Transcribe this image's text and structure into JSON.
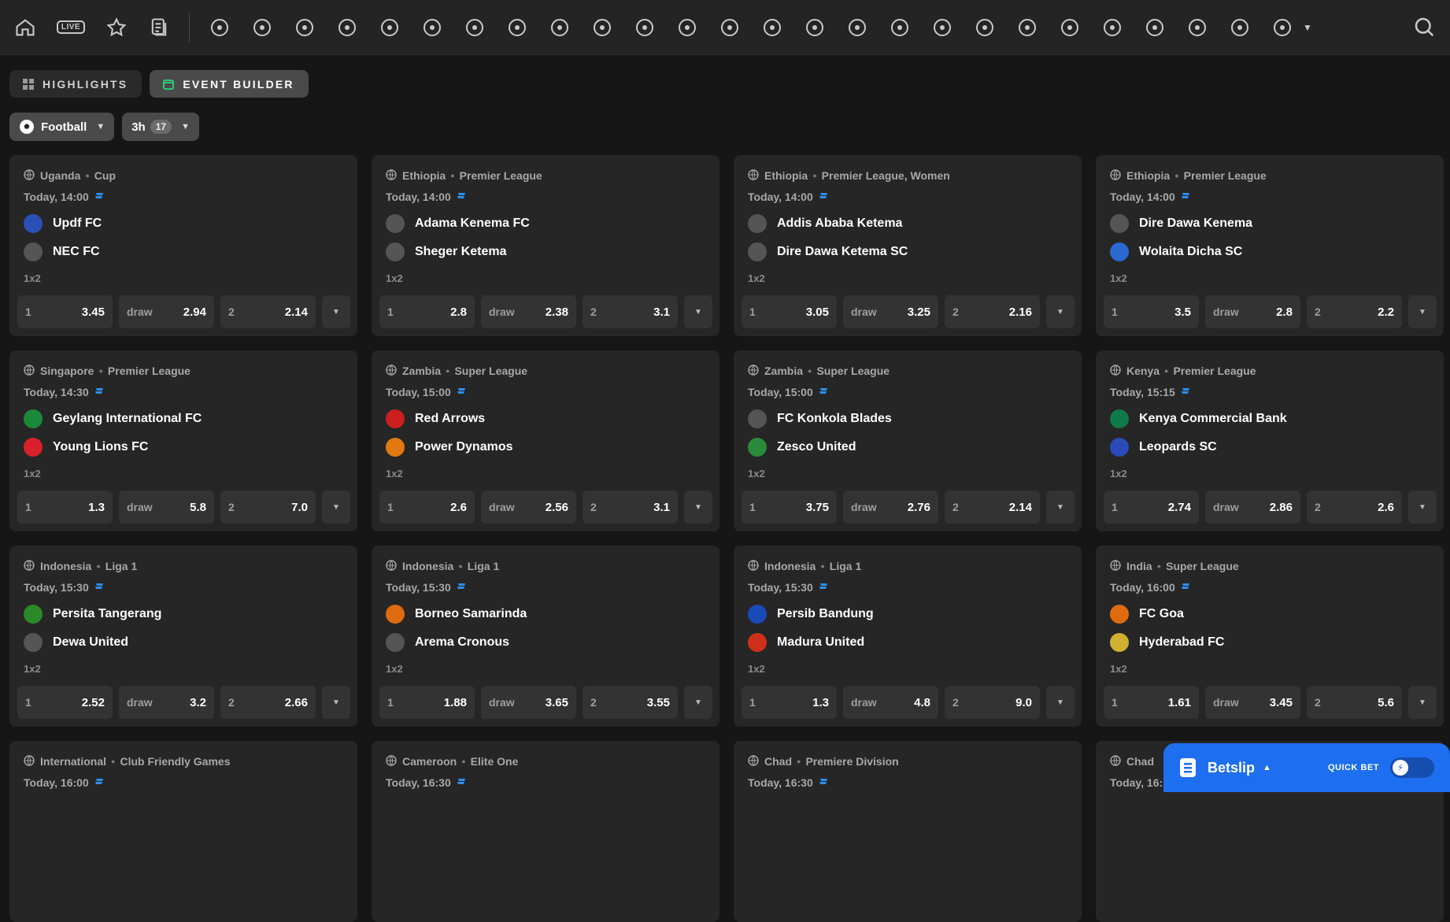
{
  "nav": {
    "live_label": "LIVE",
    "icons": [
      "home-icon",
      "live-icon",
      "star-icon",
      "betslip-list-icon",
      "football-icon",
      "basketball-icon",
      "tennis-icon",
      "esoccer-icon",
      "ice-hockey-icon",
      "table-tennis-icon",
      "counter-strike-icon",
      "dota-icon",
      "volleyball-icon",
      "handball-icon",
      "darts-icon",
      "valorant-icon",
      "volta-icon",
      "chess-icon",
      "motorsport-icon",
      "league-of-legends-icon",
      "ebasketball-icon",
      "penalty-icon",
      "fist-icon",
      "cricket-helmet-icon",
      "etennis-icon",
      "ebasketball-2-icon",
      "blitz-icon",
      "cricket-icon",
      "badminton-icon",
      "rugby-icon"
    ]
  },
  "tabs": [
    {
      "label": "HIGHLIGHTS"
    },
    {
      "label": "EVENT BUILDER"
    }
  ],
  "filters": {
    "sport": "Football",
    "time": "3h",
    "count": "17"
  },
  "matches": [
    {
      "country": "Uganda",
      "league": "Cup",
      "time": "Today, 14:00",
      "home": "Updf FC",
      "away": "NEC FC",
      "market": "1x2",
      "o1": "3.45",
      "ox": "2.94",
      "o2": "2.14",
      "home_color": "#2a50b8",
      "away_color": "#555555"
    },
    {
      "country": "Ethiopia",
      "league": "Premier League",
      "time": "Today, 14:00",
      "home": "Adama Kenema FC",
      "away": "Sheger Ketema",
      "market": "1x2",
      "o1": "2.8",
      "ox": "2.38",
      "o2": "3.1",
      "home_color": "#555555",
      "away_color": "#555555"
    },
    {
      "country": "Ethiopia",
      "league": "Premier League, Women",
      "time": "Today, 14:00",
      "home": "Addis Ababa Ketema",
      "away": "Dire Dawa Ketema SC",
      "market": "1x2",
      "o1": "3.05",
      "ox": "3.25",
      "o2": "2.16",
      "home_color": "#555555",
      "away_color": "#555555"
    },
    {
      "country": "Ethiopia",
      "league": "Premier League",
      "time": "Today, 14:00",
      "home": "Dire Dawa Kenema",
      "away": "Wolaita Dicha SC",
      "market": "1x2",
      "o1": "3.5",
      "ox": "2.8",
      "o2": "2.2",
      "home_color": "#555555",
      "away_color": "#2a6ad0"
    },
    {
      "country": "Singapore",
      "league": "Premier League",
      "time": "Today, 14:30",
      "home": "Geylang International FC",
      "away": "Young Lions FC",
      "market": "1x2",
      "o1": "1.3",
      "ox": "5.8",
      "o2": "7.0",
      "home_color": "#1a8a3a",
      "away_color": "#d8202a"
    },
    {
      "country": "Zambia",
      "league": "Super League",
      "time": "Today, 15:00",
      "home": "Red Arrows",
      "away": "Power Dynamos",
      "market": "1x2",
      "o1": "2.6",
      "ox": "2.56",
      "o2": "3.1",
      "home_color": "#cc1f1f",
      "away_color": "#e07a10"
    },
    {
      "country": "Zambia",
      "league": "Super League",
      "time": "Today, 15:00",
      "home": "FC Konkola Blades",
      "away": "Zesco United",
      "market": "1x2",
      "o1": "3.75",
      "ox": "2.76",
      "o2": "2.14",
      "home_color": "#555555",
      "away_color": "#2a8a3a"
    },
    {
      "country": "Kenya",
      "league": "Premier League",
      "time": "Today, 15:15",
      "home": "Kenya Commercial Bank",
      "away": "Leopards SC",
      "market": "1x2",
      "o1": "2.74",
      "ox": "2.86",
      "o2": "2.6",
      "home_color": "#0f7a4a",
      "away_color": "#2a4ab8"
    },
    {
      "country": "Indonesia",
      "league": "Liga 1",
      "time": "Today, 15:30",
      "home": "Persita Tangerang",
      "away": "Dewa United",
      "market": "1x2",
      "o1": "2.52",
      "ox": "3.2",
      "o2": "2.66",
      "home_color": "#2a8a2a",
      "away_color": "#555555"
    },
    {
      "country": "Indonesia",
      "league": "Liga 1",
      "time": "Today, 15:30",
      "home": "Borneo Samarinda",
      "away": "Arema Cronous",
      "market": "1x2",
      "o1": "1.88",
      "ox": "3.65",
      "o2": "3.55",
      "home_color": "#e06a10",
      "away_color": "#555555"
    },
    {
      "country": "Indonesia",
      "league": "Liga 1",
      "time": "Today, 15:30",
      "home": "Persib Bandung",
      "away": "Madura United",
      "market": "1x2",
      "o1": "1.3",
      "ox": "4.8",
      "o2": "9.0",
      "home_color": "#1a4ab8",
      "away_color": "#d0301a"
    },
    {
      "country": "India",
      "league": "Super League",
      "time": "Today, 16:00",
      "home": "FC Goa",
      "away": "Hyderabad FC",
      "market": "1x2",
      "o1": "1.61",
      "ox": "3.45",
      "o2": "5.6",
      "home_color": "#e06a10",
      "away_color": "#d0b030"
    },
    {
      "country": "International",
      "league": "Club Friendly Games",
      "time": "Today, 16:00"
    },
    {
      "country": "Cameroon",
      "league": "Elite One",
      "time": "Today, 16:30"
    },
    {
      "country": "Chad",
      "league": "Premiere Division",
      "time": "Today, 16:30"
    },
    {
      "country": "Chad",
      "league": "",
      "time": "Today, 16:"
    }
  ],
  "odds_labels": {
    "home": "1",
    "draw": "draw",
    "away": "2"
  },
  "betslip": {
    "title": "Betslip",
    "quick_bet": "QUICK BET"
  },
  "colors": {
    "accent": "#1e6ef0",
    "background": "#161616",
    "card": "#262626"
  }
}
